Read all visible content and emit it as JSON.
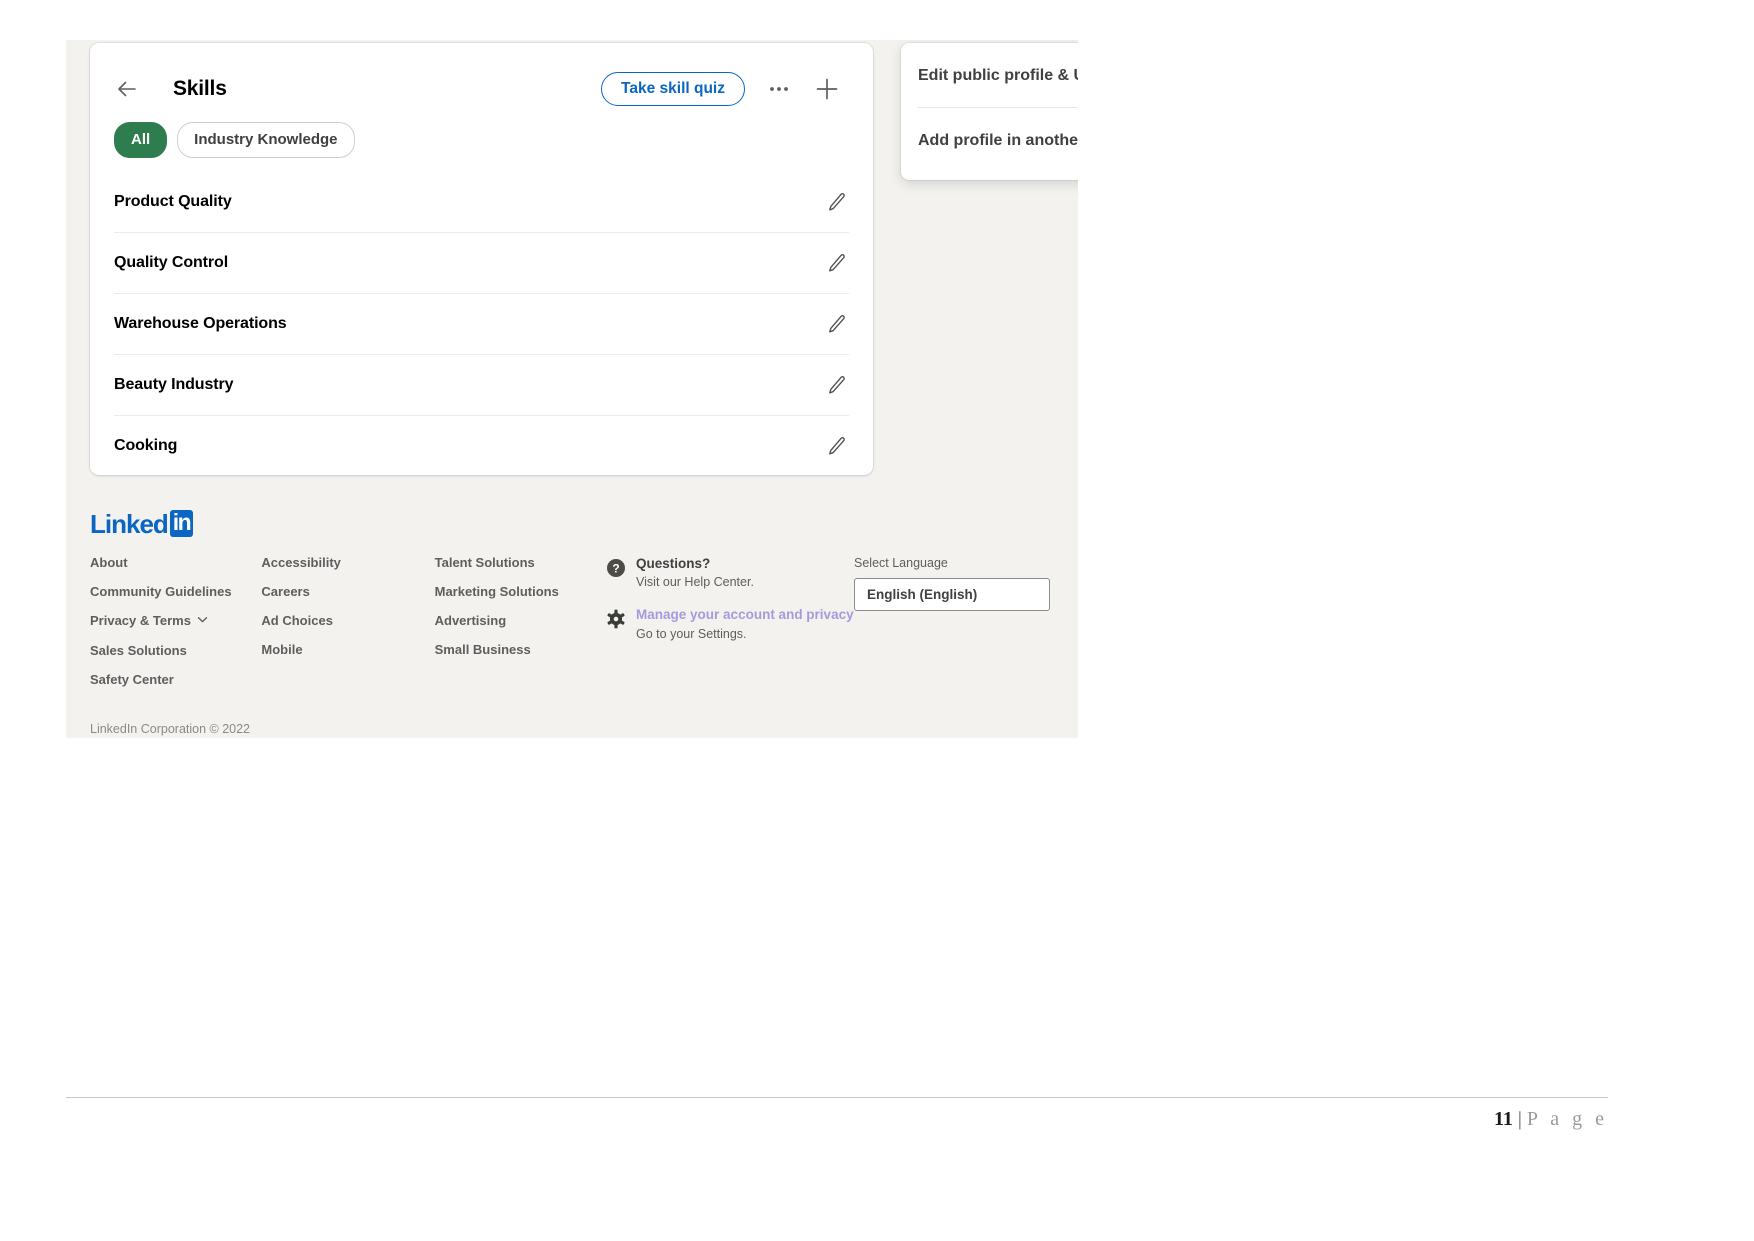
{
  "card": {
    "title": "Skills",
    "back_icon": "back-arrow-icon",
    "quiz_button": "Take skill quiz",
    "more_icon": "ellipsis-icon",
    "add_icon": "plus-icon",
    "filters": [
      {
        "label": "All",
        "selected": true
      },
      {
        "label": "Industry Knowledge",
        "selected": false
      }
    ],
    "skills": [
      {
        "name": "Product Quality"
      },
      {
        "name": "Quality Control"
      },
      {
        "name": "Warehouse Operations"
      },
      {
        "name": "Beauty Industry"
      },
      {
        "name": "Cooking"
      }
    ],
    "edit_icon": "pencil-icon"
  },
  "profile_menu": {
    "items": [
      {
        "label": "Edit public profile & U"
      },
      {
        "label": "Add profile in another"
      }
    ]
  },
  "footer": {
    "logo": {
      "word": "Linked",
      "box": "in"
    },
    "columns": [
      {
        "links": [
          {
            "label": "About",
            "chevron": false
          },
          {
            "label": "Community Guidelines",
            "chevron": false
          },
          {
            "label": "Privacy & Terms",
            "chevron": true
          },
          {
            "label": "Sales Solutions",
            "chevron": false
          },
          {
            "label": "Safety Center",
            "chevron": false
          }
        ]
      },
      {
        "links": [
          {
            "label": "Accessibility",
            "chevron": false
          },
          {
            "label": "Careers",
            "chevron": false
          },
          {
            "label": "Ad Choices",
            "chevron": false
          },
          {
            "label": "Mobile",
            "chevron": false
          }
        ]
      },
      {
        "links": [
          {
            "label": "Talent Solutions",
            "chevron": false
          },
          {
            "label": "Marketing Solutions",
            "chevron": false
          },
          {
            "label": "Advertising",
            "chevron": false
          },
          {
            "label": "Small Business",
            "chevron": false
          }
        ]
      }
    ],
    "help": {
      "questions_icon": "question-mark-circle-icon",
      "questions_title": "Questions?",
      "questions_sub": "Visit our Help Center.",
      "settings_icon": "gear-icon",
      "settings_title": "Manage your account and privacy",
      "settings_sub": "Go to your Settings."
    },
    "language": {
      "label": "Select Language",
      "value": "English (English)"
    },
    "copyright": "LinkedIn Corporation © 2022"
  },
  "document": {
    "page_number": "11",
    "separator": "|",
    "page_word": "P a g e"
  },
  "colors": {
    "linkedin_blue": "#0a66c2",
    "pill_green": "#2e7d4f",
    "lavender_link": "#a59bdc",
    "page_bg": "#f3f2ef"
  }
}
